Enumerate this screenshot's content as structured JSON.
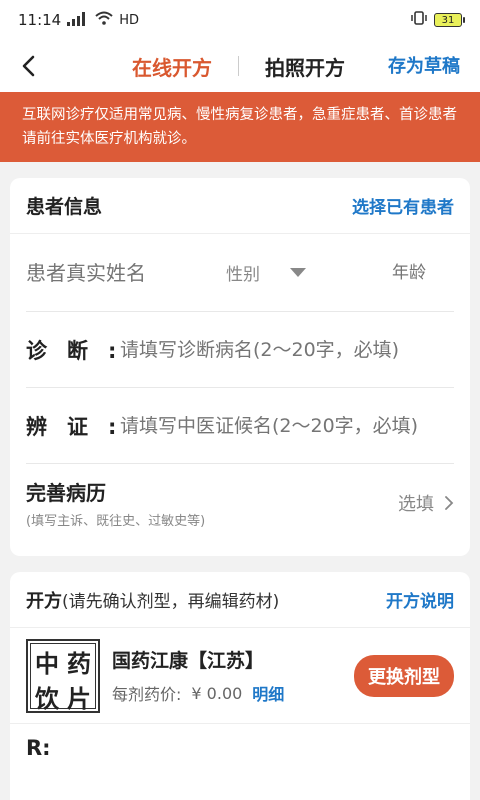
{
  "status": {
    "time": "11:14",
    "network": "4G",
    "hd": "HD",
    "battery": "31"
  },
  "nav": {
    "tabs": [
      {
        "label": "在线开方",
        "active": true
      },
      {
        "label": "拍照开方",
        "active": false
      }
    ],
    "draft": "存为草稿"
  },
  "notice": "互联网诊疗仅适用常见病、慢性病复诊患者，急重症患者、首诊患者请前往实体医疗机构就诊。",
  "patient": {
    "title": "患者信息",
    "select_existing": "选择已有患者",
    "name_placeholder": "患者真实姓名",
    "gender_placeholder": "性别",
    "age_placeholder": "年龄",
    "diagnosis": {
      "label": "诊断:",
      "placeholder": "请填写诊断病名(2～20字，必填)"
    },
    "syndrome": {
      "label": "辨证:",
      "placeholder": "请填写中医证候名(2～20字，必填)"
    },
    "history": {
      "title": "完善病历",
      "subtitle": "(填写主诉、既往史、过敏史等)",
      "action": "选填"
    }
  },
  "prescription": {
    "title": "开方",
    "hint": "(请先确认剂型，再编辑药材)",
    "instructions": "开方说明",
    "logo_chars": [
      "中",
      "药",
      "饮",
      "片"
    ],
    "pharmacy_name": "国药江康【江苏】",
    "price_label": "每剂药价:",
    "price": "¥ 0.00",
    "detail": "明细",
    "change_type": "更换剂型",
    "rx_label": "R:"
  },
  "colors": {
    "accent": "#dc5b38",
    "link": "#1f78c8"
  }
}
